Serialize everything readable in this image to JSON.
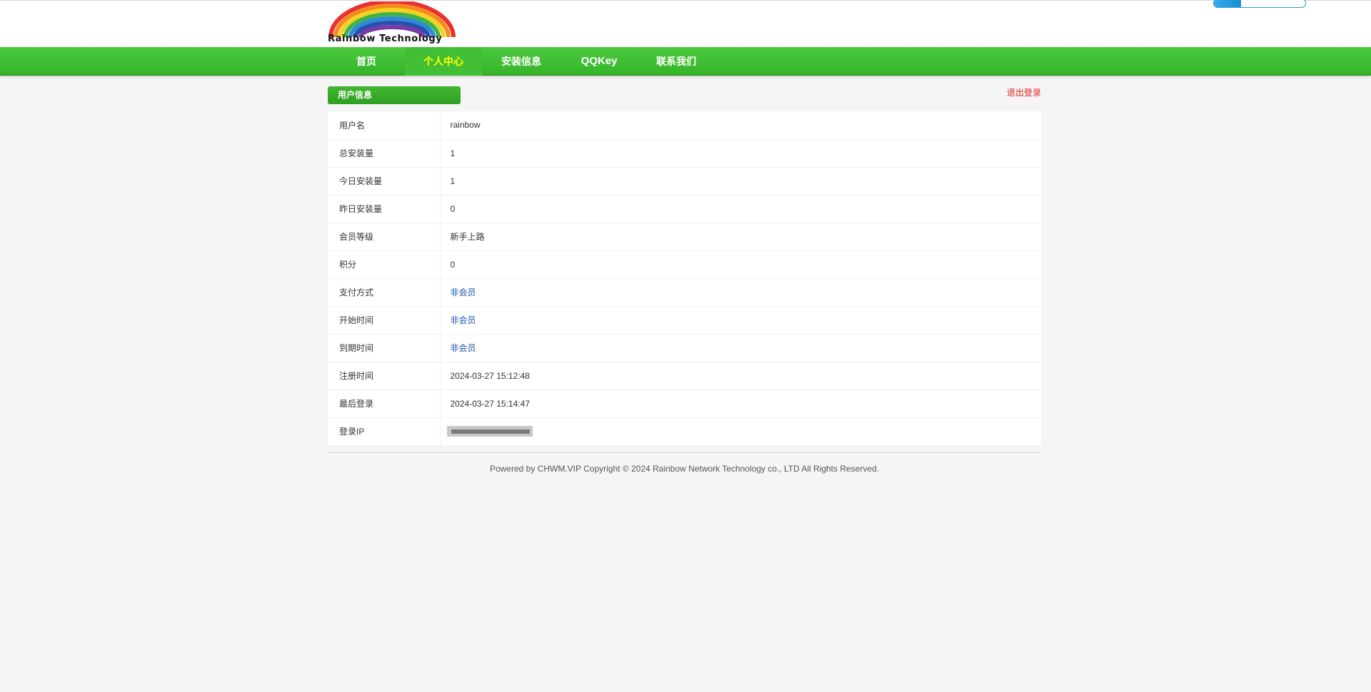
{
  "header": {
    "logo_text": "Rainbow Technology"
  },
  "nav": {
    "items": [
      {
        "label": "首页"
      },
      {
        "label": "个人中心"
      },
      {
        "label": "安装信息"
      },
      {
        "label": "QQKey"
      },
      {
        "label": "联系我们"
      }
    ],
    "active_index": 1
  },
  "section": {
    "title": "用户信息",
    "logout_label": "退出登录"
  },
  "user_info": {
    "rows": [
      {
        "label": "用户名",
        "value": "rainbow"
      },
      {
        "label": "总安装量",
        "value": "1"
      },
      {
        "label": "今日安装量",
        "value": "1"
      },
      {
        "label": "昨日安装量",
        "value": "0"
      },
      {
        "label": "会员等级",
        "value": "新手上路"
      },
      {
        "label": "积分",
        "value": "0"
      },
      {
        "label": "支付方式",
        "value": "非会员"
      },
      {
        "label": "开始时间",
        "value": "非会员"
      },
      {
        "label": "到期时间",
        "value": "非会员"
      },
      {
        "label": "注册时间",
        "value": "2024-03-27 15:12:48"
      },
      {
        "label": "最后登录",
        "value": "2024-03-27 15:14:47"
      },
      {
        "label": "登录IP",
        "value": ""
      }
    ]
  },
  "footer": {
    "text": "Powered by CHWM.VIP Copyright © 2024 Rainbow Network Technology co., LTD All Rights Reserved."
  },
  "colors": {
    "nav_green": "#3cbd2f",
    "active_nav_text": "#ffff00",
    "logout_red": "#e02020",
    "link_blue": "#1e57a8"
  }
}
